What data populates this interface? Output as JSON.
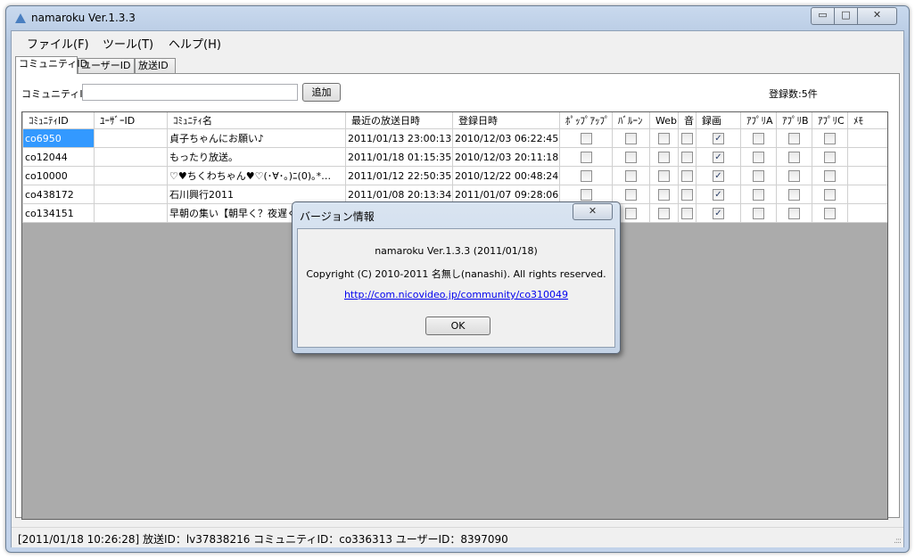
{
  "window": {
    "title": "namaroku Ver.1.3.3",
    "min_glyph": "▭",
    "max_glyph": "□",
    "close_glyph": "✕"
  },
  "menu": [
    "ファイル(F)",
    "ツール(T)",
    "ヘルプ(H)"
  ],
  "tabs": [
    "コミュニティID",
    "ユーザーID",
    "放送ID"
  ],
  "form": {
    "community_label": "コミュニティID:",
    "community_value": "",
    "add_button": "追加",
    "count_text": "登録数:5件"
  },
  "table": {
    "columns": [
      "ｺﾐｭﾆﾃｨID",
      "ﾕｰｻﾞｰID",
      "ｺﾐｭﾆﾃｨ名",
      "最近の放送日時",
      "登録日時",
      "ﾎﾟｯﾌﾟｱｯﾌﾟ",
      "ﾊﾞﾙｰﾝ",
      "Web",
      "音",
      "録画",
      "ｱﾌﾟﾘA",
      "ｱﾌﾟﾘB",
      "ｱﾌﾟﾘC",
      "ﾒﾓ"
    ],
    "rows": [
      {
        "community_id": "co6950",
        "user_id": "",
        "name": "貞子ちゃんにお願い♪",
        "last_broadcast": "2011/01/13 23:00:13",
        "registered": "2010/12/03 06:22:45",
        "popup": false,
        "balloon": false,
        "web": false,
        "sound": false,
        "record": true,
        "app_a": false,
        "app_b": false,
        "app_c": false,
        "memo": ""
      },
      {
        "community_id": "co12044",
        "user_id": "",
        "name": "もったり放送。",
        "last_broadcast": "2011/01/18 01:15:35",
        "registered": "2010/12/03 20:11:18",
        "popup": false,
        "balloon": false,
        "web": false,
        "sound": false,
        "record": true,
        "app_a": false,
        "app_b": false,
        "app_c": false,
        "memo": ""
      },
      {
        "community_id": "co10000",
        "user_id": "",
        "name": "♡♥ちくわちゃん♥♡(･∀･｡)ﾆ(0)｡*…",
        "last_broadcast": "2011/01/12 22:50:35",
        "registered": "2010/12/22 00:48:24",
        "popup": false,
        "balloon": false,
        "web": false,
        "sound": false,
        "record": true,
        "app_a": false,
        "app_b": false,
        "app_c": false,
        "memo": ""
      },
      {
        "community_id": "co438172",
        "user_id": "",
        "name": "石川興行2011",
        "last_broadcast": "2011/01/08 20:13:34",
        "registered": "2011/01/07 09:28:06",
        "popup": false,
        "balloon": false,
        "web": false,
        "sound": false,
        "record": true,
        "app_a": false,
        "app_b": false,
        "app_c": false,
        "memo": ""
      },
      {
        "community_id": "co134151",
        "user_id": "",
        "name": "早朝の集い【朝早く？夜遅く",
        "last_broadcast": "",
        "registered": "",
        "popup": false,
        "balloon": false,
        "web": false,
        "sound": false,
        "record": true,
        "app_a": false,
        "app_b": false,
        "app_c": false,
        "memo": ""
      }
    ],
    "check_mark": "✓"
  },
  "status": {
    "text": "[2011/01/18 10:26:28]  放送ID：lv37838216   コミュニティID：co336313   ユーザーID：8397090",
    "grip": ".:::"
  },
  "dialog": {
    "title": "バージョン情報",
    "close_glyph": "✕",
    "version": "namaroku Ver.1.3.3 (2011/01/18)",
    "copyright": "Copyright (C) 2010-2011 名無し(nanashi). All rights reserved.",
    "link": "http://com.nicovideo.jp/community/co310049",
    "ok": "OK"
  }
}
